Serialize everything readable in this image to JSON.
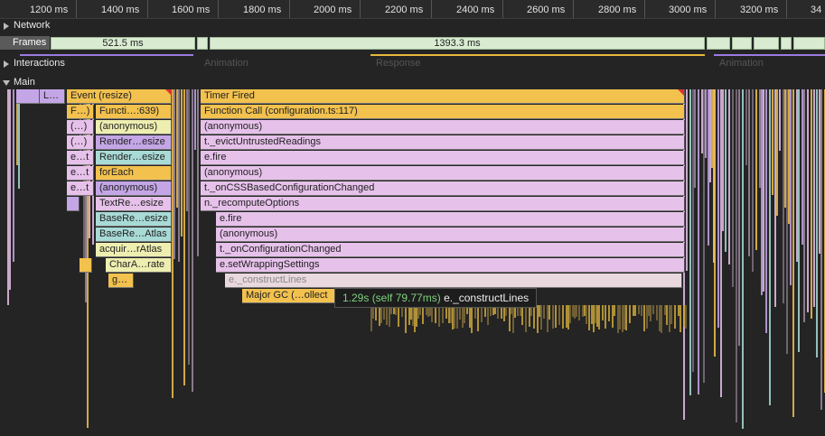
{
  "ruler": {
    "ticks": [
      "1200 ms",
      "1400 ms",
      "1600 ms",
      "1800 ms",
      "2000 ms",
      "2200 ms",
      "2400 ms",
      "2600 ms",
      "2800 ms",
      "3000 ms",
      "3200 ms",
      "34"
    ]
  },
  "tracks": {
    "network": "Network",
    "frames": "Frames",
    "interactions": "Interactions",
    "main": "Main"
  },
  "frames": {
    "f1": "521.5 ms",
    "f2": "1393.3 ms"
  },
  "interactions": {
    "animation1": "Animation",
    "response": "Response",
    "animation2": "Animation"
  },
  "flame": {
    "left": {
      "row0a": "L…",
      "event_resize": "Event (resize)",
      "f_close": "F…)",
      "functi": "Functi…:639)",
      "anon1_a": "(…)",
      "anon1_b": "(anonymous)",
      "anon2_a": "(…)",
      "render1": "Render…esize",
      "et1": "e…t",
      "render2": "Render…esize",
      "et2": "e…t",
      "foreach": "forEach",
      "et3": "e…t",
      "anon3": "(anonymous)",
      "textre": "TextRe…esize",
      "basere1": "BaseRe…esize",
      "basere2": "BaseRe…Atlas",
      "acquir": "acquir…rAtlas",
      "chara": "CharA…rate",
      "g": "g…"
    },
    "main": {
      "timer_fired": "Timer Fired",
      "function_call": "Function Call (configuration.ts:117)",
      "anonymous1": "(anonymous)",
      "evict": "t._evictUntrustedReadings",
      "efire1": "e.fire",
      "anonymous2": "(anonymous)",
      "oncss": "t._onCSSBasedConfigurationChanged",
      "recompute": "n._recomputeOptions",
      "efire2": "e.fire",
      "anonymous3": "(anonymous)",
      "onconfig": "t._onConfigurationChanged",
      "setwrap": "e.setWrappingSettings",
      "construct": "e._constructLines",
      "majorgc": "Major GC (…ollect"
    }
  },
  "tooltip": {
    "duration": "1.29s (self 79.77ms)",
    "name": "e._constructLines"
  },
  "colors": {
    "task": "#f2c14e",
    "script": "#e6c1ea",
    "frame_bg": "#d9ecd2",
    "tooltip_duration": "#7ed27e"
  }
}
